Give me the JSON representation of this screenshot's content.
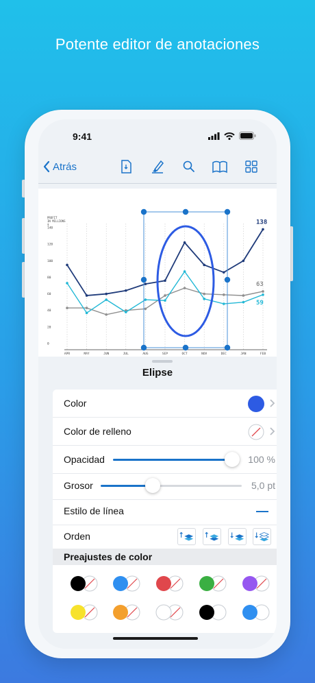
{
  "headline": "Potente editor de anotaciones",
  "status": {
    "time": "9:41"
  },
  "nav": {
    "back_label": "Atrás",
    "icons": [
      "document-icon",
      "highlighter-icon",
      "search-icon",
      "book-icon",
      "grid-icon"
    ]
  },
  "chart_data": {
    "type": "line",
    "ylabel": "PROFIT IN MILLIONS $",
    "categories": [
      "APR",
      "MAY",
      "JUN",
      "JUL",
      "AUG",
      "SEP",
      "OCT",
      "NOV",
      "DEC",
      "JAN",
      "FEB"
    ],
    "yticks": [
      0,
      20,
      40,
      60,
      80,
      100,
      120,
      140
    ],
    "ylim": [
      0,
      140
    ],
    "series": [
      {
        "color": "#1f3b7a",
        "values": [
          95,
          58,
          60,
          64,
          72,
          76,
          122,
          95,
          86,
          100,
          138
        ]
      },
      {
        "color": "#8f8f8f",
        "values": [
          43,
          43,
          35,
          40,
          42,
          58,
          67,
          60,
          59,
          58,
          63
        ]
      },
      {
        "color": "#22b8d6",
        "values": [
          73,
          37,
          53,
          38,
          53,
          52,
          87,
          54,
          48,
          50,
          59
        ]
      }
    ],
    "end_labels": [
      "138",
      "63",
      "59"
    ]
  },
  "sheet": {
    "title": "Elipse",
    "color_label": "Color",
    "fill_label": "Color de relleno",
    "opacity_label": "Opacidad",
    "opacity_value": "100 %",
    "opacity_level": 1.0,
    "thickness_label": "Grosor",
    "thickness_value": "5,0 pt",
    "thickness_level": 0.37,
    "linestyle_label": "Estilo de línea",
    "order_label": "Orden",
    "presets_label": "Preajustes de color",
    "stroke_color": "#2d5be3",
    "accent": "#1a73c9",
    "presets": [
      {
        "a": "#000000",
        "b": "none"
      },
      {
        "a": "#2f8ff0",
        "b": "none"
      },
      {
        "a": "#e0474c",
        "b": "none"
      },
      {
        "a": "#3aaf42",
        "b": "none"
      },
      {
        "a": "#9657f0",
        "b": "none"
      },
      {
        "a": "#f7e22c",
        "b": "none"
      },
      {
        "a": "#f39f2d",
        "b": "none"
      },
      {
        "a": "#ffffff",
        "b": "none"
      },
      {
        "a": "#000000",
        "b": "#ffffff"
      },
      {
        "a": "#2f8ff0",
        "b": "#ffffff"
      }
    ]
  }
}
